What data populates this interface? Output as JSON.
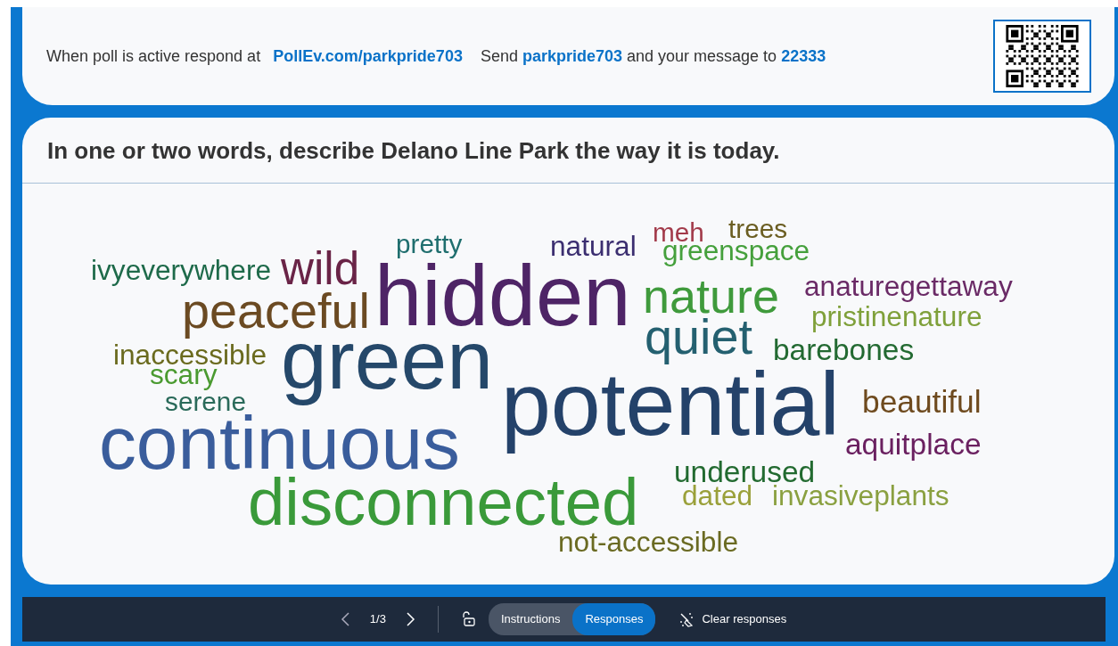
{
  "header": {
    "prompt": "When poll is active respond at",
    "url": "PollEv.com/parkpride703",
    "sms": "Send **parkpride703** and your message to **22333**"
  },
  "question": {
    "title": "In one or two words, describe Delano Line Park the way it is today.",
    "words": [
      {
        "text": "pretty",
        "color": "#1f6e6e"
      },
      {
        "text": "greenspace",
        "color": "#45a03c"
      },
      {
        "text": "natural",
        "color": "#3b2e70"
      },
      {
        "text": "ivyeverywhere",
        "color": "#1e6a4a"
      },
      {
        "text": "hidden",
        "color": "#4e2466"
      },
      {
        "text": "trees",
        "color": "#6b5e22"
      },
      {
        "text": "meh",
        "color": "#a23a4a"
      },
      {
        "text": "nature",
        "color": "#3f9a3c"
      },
      {
        "text": "anaturegettaway",
        "color": "#6a2a66"
      },
      {
        "text": "wild",
        "color": "#6a2447"
      },
      {
        "text": "pristinenature",
        "color": "#7fa03a"
      },
      {
        "text": "inaccessible",
        "color": "#6a6a1e"
      },
      {
        "text": "quiet",
        "color": "#246070"
      },
      {
        "text": "green",
        "color": "#25486a"
      },
      {
        "text": "barebones",
        "color": "#236a32"
      },
      {
        "text": "peaceful",
        "color": "#6b4a22"
      },
      {
        "text": "scary",
        "color": "#4a9a30"
      },
      {
        "text": "serene",
        "color": "#2a6a5a"
      },
      {
        "text": "potential",
        "color": "#24426a"
      },
      {
        "text": "beautiful",
        "color": "#6e4a1e"
      },
      {
        "text": "continuous",
        "color": "#3a5d9c"
      },
      {
        "text": "aquitplace",
        "color": "#6a2060"
      },
      {
        "text": "underused",
        "color": "#226a30"
      },
      {
        "text": "disconnected",
        "color": "#3a9a3a"
      },
      {
        "text": "dated",
        "color": "#9aa03a"
      },
      {
        "text": "invasiveplants",
        "color": "#8aa040"
      },
      {
        "text": "not-accessible",
        "color": "#6a6a22"
      }
    ]
  },
  "toolbar": {
    "page": "1/3",
    "views": [
      {
        "label": "Instructions",
        "selected": false
      },
      {
        "label": "Responses",
        "selected": true
      }
    ],
    "clear": "Clear responses"
  }
}
